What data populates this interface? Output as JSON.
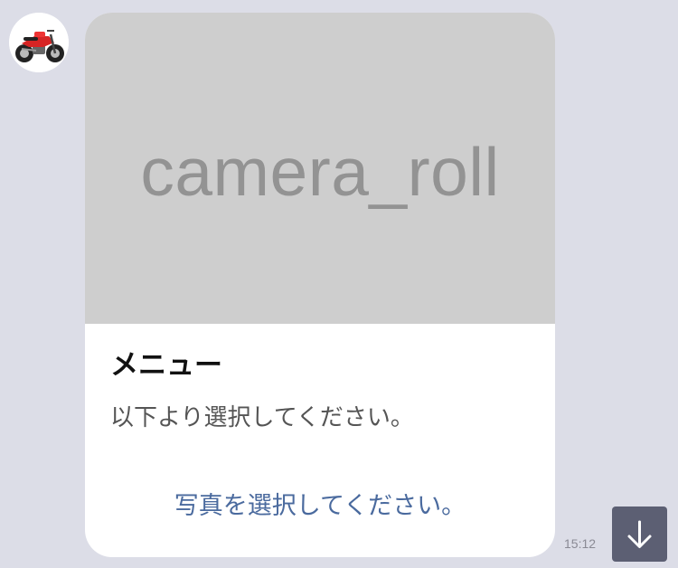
{
  "chat": {
    "avatar_icon": "motorcycle-icon",
    "timestamp": "15:12"
  },
  "card": {
    "hero_text": "camera_roll",
    "title": "メニュー",
    "text": "以下より選択してください。",
    "action_label": "写真を選択してください。"
  },
  "controls": {
    "scroll_down_icon": "arrow-down-icon"
  },
  "colors": {
    "background": "#dcdde7",
    "hero_background": "#cecece",
    "hero_text": "#939393",
    "action_link": "#4a6a9e",
    "scroll_button": "#5c5f73"
  }
}
